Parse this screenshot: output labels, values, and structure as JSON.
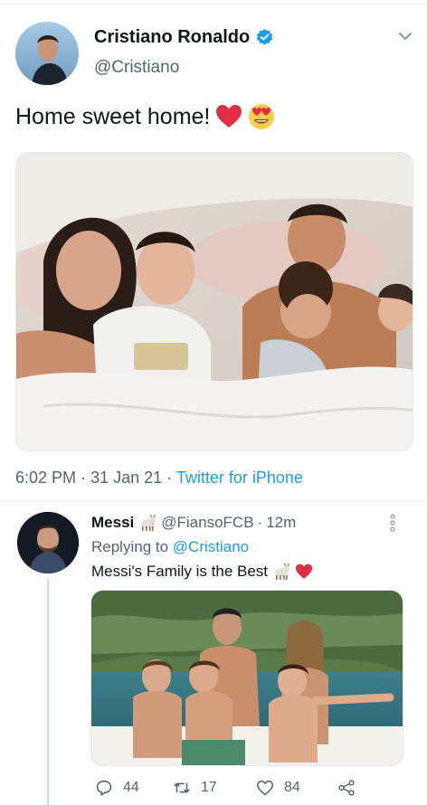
{
  "tweet": {
    "author_name": "Cristiano Ronaldo",
    "author_handle": "@Cristiano",
    "text": "Home sweet home!",
    "emojis": [
      "red-heart",
      "heart-eyes"
    ],
    "time": "6:02 PM",
    "date": "31 Jan 21",
    "source": "Twitter for iPhone",
    "separator": "·",
    "media": "photo-family-on-bed",
    "verified": true
  },
  "reply": {
    "author_name": "Messi",
    "author_handle": "@FiansoFCB",
    "age": "12m",
    "replying_label": "Replying to",
    "replying_to": "@Cristiano",
    "text": "Messi's Family is the Best",
    "emojis": [
      "goat",
      "red-heart"
    ],
    "media": "photo-family-on-boat",
    "counts": {
      "replies": "44",
      "retweets": "17",
      "likes": "84"
    }
  },
  "colors": {
    "link": "#1d9bf0",
    "muted": "#536471",
    "text": "#0f1419",
    "heart": "#e0245e",
    "divider": "#eceff1"
  }
}
